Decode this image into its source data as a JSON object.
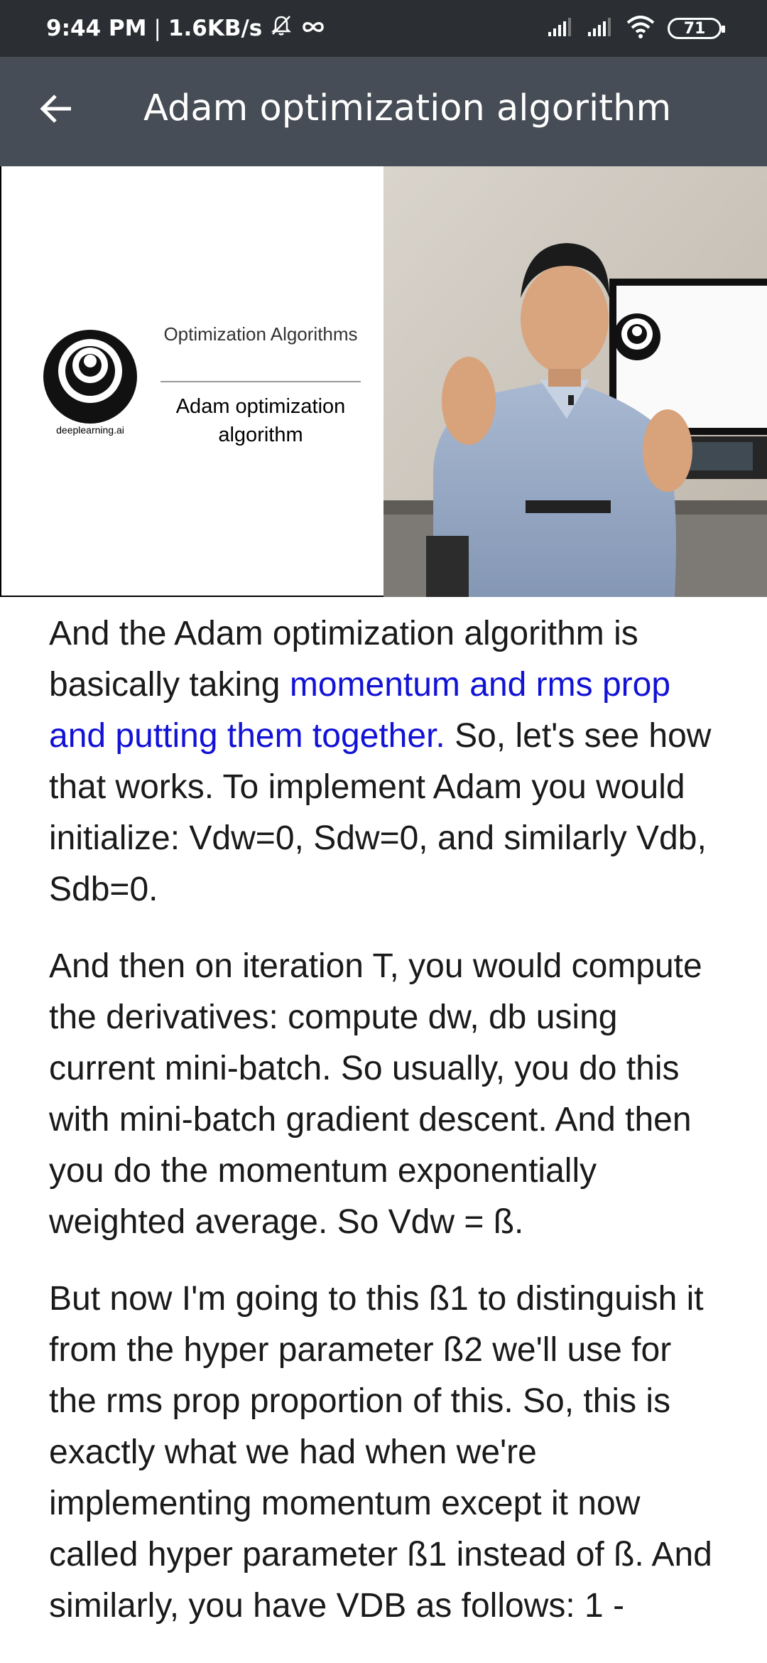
{
  "status_bar": {
    "time": "9:44 PM",
    "separator": "|",
    "network_speed": "1.6KB/s",
    "battery_level": "71",
    "icons": [
      "mute-bell-icon",
      "infinity-icon",
      "signal-icon",
      "signal-icon",
      "wifi-icon",
      "battery-icon"
    ]
  },
  "app_bar": {
    "title": "Adam optimization algorithm",
    "back_icon": "arrow-back-icon"
  },
  "video": {
    "logo_caption": "deeplearning.ai",
    "section_title": "Optimization Algorithms",
    "topic_title": "Adam optimization algorithm"
  },
  "transcript": {
    "para1_start": "And the Adam optimization algorithm is basically taking ",
    "para1_highlight": "momentum and rms prop and putting them together.",
    "para1_end": " So, let's see how that works. To implement Adam you would initialize: Vdw=0, Sdw=0, and similarly Vdb, Sdb=0.",
    "para2": "And then on iteration T, you would compute the derivatives: compute dw, db using current mini-batch. So usually, you do this with mini-batch gradient descent. And then you do the momentum exponentially weighted average.  So Vdw = ß.",
    "para3": "But now I'm going to this ß1 to distinguish it from the hyper parameter ß2 we'll use for the rms prop proportion of this. So, this is exactly what we had when we're implementing momentum except it now called hyper parameter ß1 instead of ß. And similarly, you have VDB as follows: 1 -"
  },
  "colors": {
    "status_bar_bg": "#2b2f33",
    "app_bar_bg": "#474d56",
    "highlight_text": "#1212d6",
    "body_text": "#1a1a1a"
  }
}
